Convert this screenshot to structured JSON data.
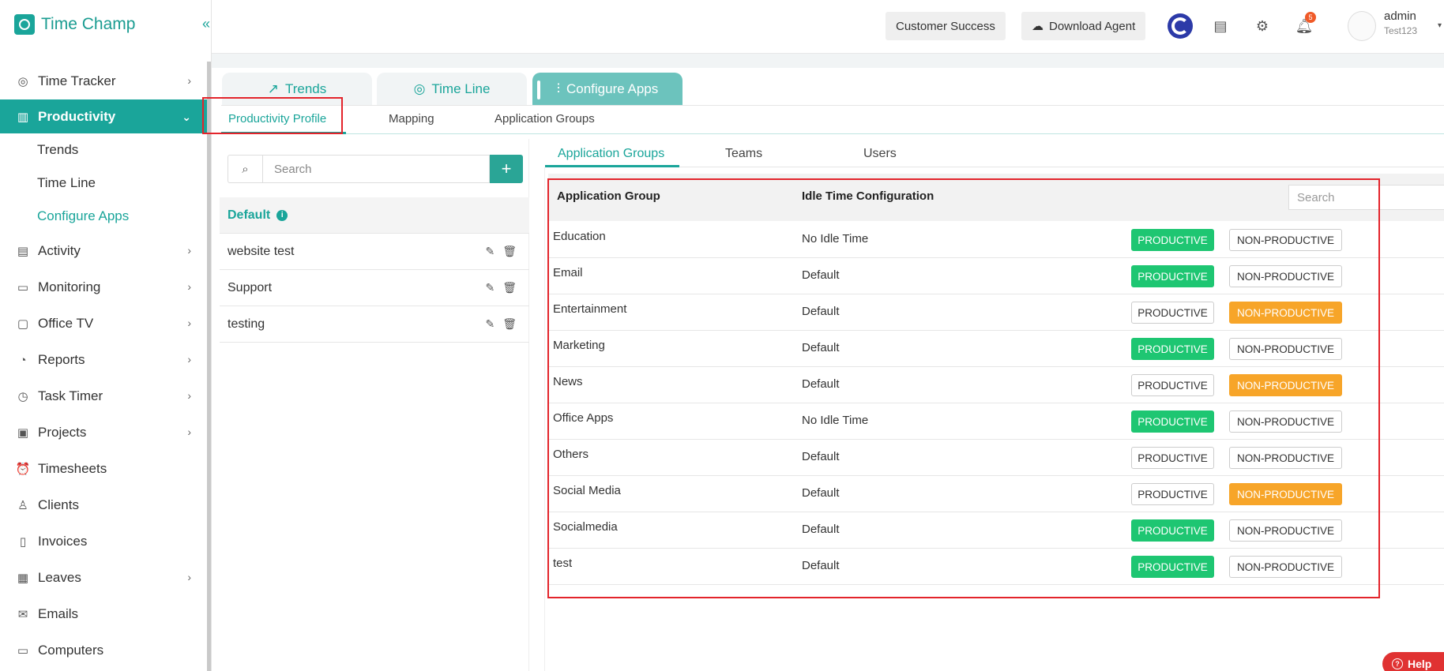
{
  "brand": {
    "name": "Time Champ",
    "collapse_icon": "double-chevron-left-icon"
  },
  "sidebar": {
    "items": [
      {
        "label": "Time Tracker",
        "icon": "target-icon",
        "chevron": true
      },
      {
        "label": "Productivity",
        "icon": "bar-chart-icon",
        "chevron": true,
        "active": true
      },
      {
        "label": "Activity",
        "icon": "ticket-icon",
        "chevron": true
      },
      {
        "label": "Monitoring",
        "icon": "monitor-icon",
        "chevron": true
      },
      {
        "label": "Office TV",
        "icon": "tv-icon",
        "chevron": true
      },
      {
        "label": "Reports",
        "icon": "pie-chart-icon",
        "chevron": true
      },
      {
        "label": "Task Timer",
        "icon": "stopwatch-icon",
        "chevron": true
      },
      {
        "label": "Projects",
        "icon": "briefcase-icon",
        "chevron": true
      },
      {
        "label": "Timesheets",
        "icon": "alarm-clock-icon",
        "chevron": false
      },
      {
        "label": "Clients",
        "icon": "user-icon",
        "chevron": false
      },
      {
        "label": "Invoices",
        "icon": "invoice-icon",
        "chevron": false
      },
      {
        "label": "Leaves",
        "icon": "calendar-icon",
        "chevron": true
      },
      {
        "label": "Emails",
        "icon": "mail-icon",
        "chevron": false
      },
      {
        "label": "Computers",
        "icon": "computer-icon",
        "chevron": false
      }
    ],
    "sub_items": [
      "Trends",
      "Time Line",
      "Configure Apps"
    ]
  },
  "topbar": {
    "customer_success": "Customer Success",
    "download_agent": "Download Agent",
    "notification_count": "5",
    "user_name": "admin",
    "user_org": "Test123"
  },
  "main_tabs": [
    "Trends",
    "Time Line",
    "Configure Apps"
  ],
  "sub_tabs": [
    "Productivity Profile",
    "Mapping",
    "Application Groups"
  ],
  "left_panel": {
    "search_placeholder": "Search",
    "default_profile": "Default",
    "profiles": [
      "website test",
      "Support",
      "testing"
    ]
  },
  "inner_tabs": [
    "Application Groups",
    "Teams",
    "Users"
  ],
  "grid": {
    "col_group": "Application Group",
    "col_idle": "Idle Time Configuration",
    "search_placeholder": "Search",
    "productive_label": "PRODUCTIVE",
    "non_productive_label": "NON-PRODUCTIVE",
    "rows": [
      {
        "name": "Education",
        "idle": "No Idle Time",
        "status": "productive"
      },
      {
        "name": "Email",
        "idle": "Default",
        "status": "productive"
      },
      {
        "name": "Entertainment",
        "idle": "Default",
        "status": "non-productive"
      },
      {
        "name": "Marketing",
        "idle": "Default",
        "status": "productive"
      },
      {
        "name": "News",
        "idle": "Default",
        "status": "non-productive"
      },
      {
        "name": "Office Apps",
        "idle": "No Idle Time",
        "status": "productive"
      },
      {
        "name": "Others",
        "idle": "Default",
        "status": "none"
      },
      {
        "name": "Social Media",
        "idle": "Default",
        "status": "non-productive"
      },
      {
        "name": "Socialmedia",
        "idle": "Default",
        "status": "productive"
      },
      {
        "name": "test",
        "idle": "Default",
        "status": "productive"
      }
    ]
  },
  "help": {
    "label": "Help"
  },
  "colors": {
    "brand": "#1aa59a",
    "productive": "#1ec672",
    "non_productive": "#f7a529",
    "highlight": "#e3242b"
  }
}
